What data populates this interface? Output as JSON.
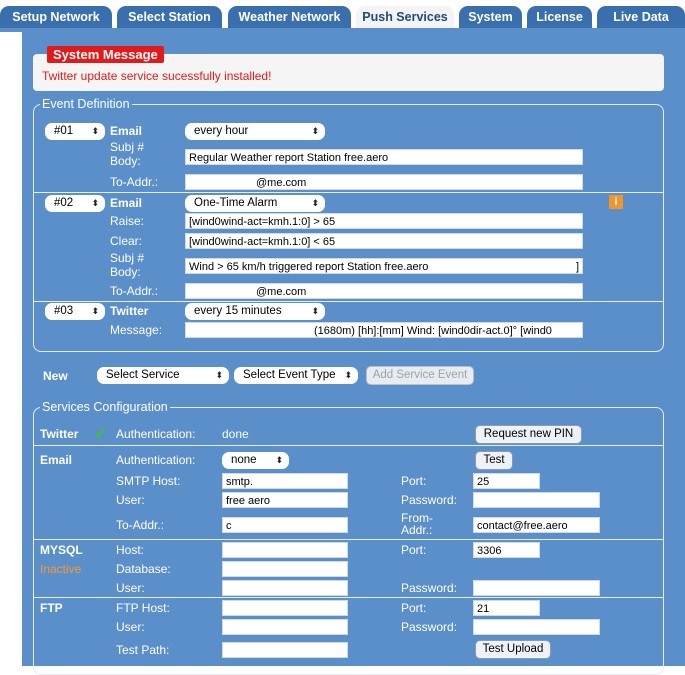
{
  "tabs": [
    {
      "label": "Setup Network"
    },
    {
      "label": "Select Station"
    },
    {
      "label": "Weather Network"
    },
    {
      "label": "Push Services"
    },
    {
      "label": "System"
    },
    {
      "label": "License"
    },
    {
      "label": "Live Data"
    }
  ],
  "active_tab": "Push Services",
  "system_message": {
    "title": "System Message",
    "text": "Twitter update service sucessfully installed!"
  },
  "event_definition": {
    "legend": "Event Definition",
    "events": [
      {
        "number": "#01",
        "type": "Email",
        "frequency": "every hour",
        "subj_label": "Subj #",
        "body_label": "Body:",
        "body_value": "Regular Weather report Station free.aero",
        "to_label": "To-Addr.:",
        "to_value": "@me.com"
      },
      {
        "number": "#02",
        "type": "Email",
        "frequency": "One-Time Alarm",
        "info_icon": "i",
        "raise_label": "Raise:",
        "raise_value": "[wind0wind-act=kmh.1:0] > 65",
        "clear_label": "Clear:",
        "clear_value": "[wind0wind-act=kmh.1:0] < 65",
        "subj_label": "Subj #",
        "body_label": "Body:",
        "body_value": "Wind > 65 km/h triggered report Station free.aero",
        "body_tail": "]",
        "to_label": "To-Addr.:",
        "to_value": "@me.com"
      },
      {
        "number": "#03",
        "type": "Twitter",
        "frequency": "every 15 minutes",
        "message_label": "Message:",
        "message_value": "(1680m) [hh]:[mm] Wind: [wind0dir-act.0]°    [wind0"
      }
    ]
  },
  "new_row": {
    "label": "New",
    "service_select": "Select Service",
    "event_type_select": "Select Event Type",
    "add_button": "Add Service Event"
  },
  "services": {
    "legend": "Services Configuration",
    "twitter": {
      "name": "Twitter",
      "auth_label": "Authentication:",
      "auth_value": "done",
      "pin_button": "Request new PIN"
    },
    "email": {
      "name": "Email",
      "auth_label": "Authentication:",
      "auth_select": "none",
      "test_button": "Test",
      "smtp_label": "SMTP Host:",
      "smtp_value": "smtp.",
      "port_label": "Port:",
      "port_value": "25",
      "user_label": "User:",
      "user_value": "free aero",
      "password_label": "Password:",
      "to_label": "To-Addr.:",
      "to_value": "c",
      "from_label_1": "From-",
      "from_label_2": "Addr.:",
      "from_value": "contact@free.aero"
    },
    "mysql": {
      "name": "MYSQL",
      "status": "Inactive",
      "host_label": "Host:",
      "database_label": "Database:",
      "user_label": "User:",
      "port_label": "Port:",
      "port_value": "3306",
      "password_label": "Password:"
    },
    "ftp": {
      "name": "FTP",
      "host_label": "FTP Host:",
      "user_label": "User:",
      "path_label": "Test Path:",
      "port_label": "Port:",
      "port_value": "21",
      "password_label": "Password:",
      "upload_button": "Test Upload"
    }
  },
  "colors": {
    "accent_blue": "#5b8fca",
    "tab_blue": "#3a6fae",
    "alert_red": "#e21a1a",
    "inactive_orange": "#f39c2e",
    "check_green": "#3fbf3f"
  },
  "icons": {
    "select_arrow": "⬍",
    "check": "✔"
  }
}
